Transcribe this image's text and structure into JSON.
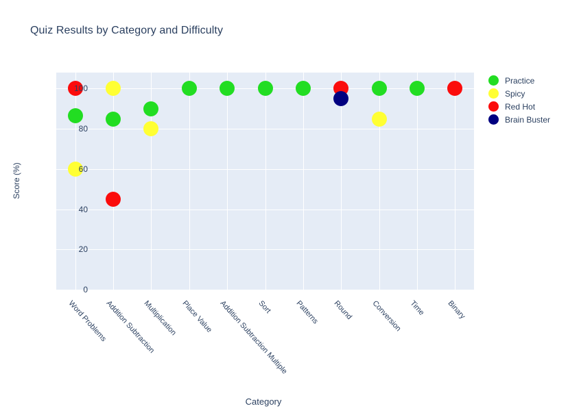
{
  "chart_data": {
    "type": "scatter",
    "title": "Quiz Results by Category and Difficulty",
    "xlabel": "Category",
    "ylabel": "Score (%)",
    "ylim": [
      0,
      108
    ],
    "yticks": [
      0,
      20,
      40,
      60,
      80,
      100
    ],
    "grid": true,
    "legend_position": "right",
    "categories": [
      "Word Problems",
      "Addition Subtraction",
      "Multiplication",
      "Place Value",
      "Addition Subtraction Multiple",
      "Sort",
      "Patterns",
      "Round",
      "Conversion",
      "Time",
      "Binary"
    ],
    "series": [
      {
        "name": "Practice",
        "color": "#22dd22",
        "points": [
          {
            "category": "Word Problems",
            "value": 86.5
          },
          {
            "category": "Addition Subtraction",
            "value": 85
          },
          {
            "category": "Multiplication",
            "value": 90
          },
          {
            "category": "Place Value",
            "value": 100
          },
          {
            "category": "Addition Subtraction Multiple",
            "value": 100
          },
          {
            "category": "Sort",
            "value": 100
          },
          {
            "category": "Patterns",
            "value": 100
          },
          {
            "category": "Conversion",
            "value": 100
          },
          {
            "category": "Time",
            "value": 100
          }
        ]
      },
      {
        "name": "Spicy",
        "color": "#ffff33",
        "points": [
          {
            "category": "Word Problems",
            "value": 60
          },
          {
            "category": "Addition Subtraction",
            "value": 100
          },
          {
            "category": "Multiplication",
            "value": 80
          },
          {
            "category": "Conversion",
            "value": 85
          }
        ]
      },
      {
        "name": "Red Hot",
        "color": "#fb0c0c",
        "points": [
          {
            "category": "Word Problems",
            "value": 100
          },
          {
            "category": "Addition Subtraction",
            "value": 45
          },
          {
            "category": "Round",
            "value": 100
          },
          {
            "category": "Binary",
            "value": 100
          }
        ]
      },
      {
        "name": "Brain Buster",
        "color": "#000080",
        "points": [
          {
            "category": "Round",
            "value": 95
          }
        ]
      }
    ]
  }
}
